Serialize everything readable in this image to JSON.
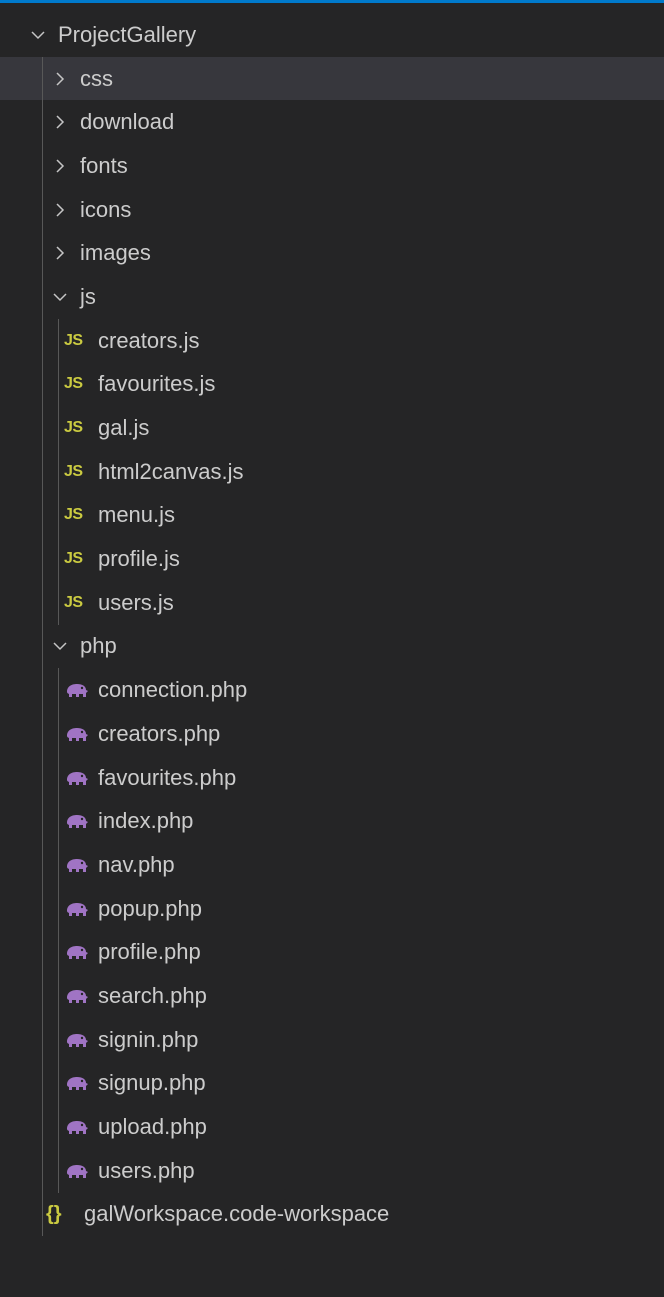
{
  "explorer": {
    "root": {
      "label": "ProjectGallery",
      "expanded": true
    },
    "folders_collapsed": [
      {
        "label": "css"
      },
      {
        "label": "download"
      },
      {
        "label": "fonts"
      },
      {
        "label": "icons"
      },
      {
        "label": "images"
      }
    ],
    "js_folder": {
      "label": "js",
      "files": [
        {
          "label": "creators.js"
        },
        {
          "label": "favourites.js"
        },
        {
          "label": "gal.js"
        },
        {
          "label": "html2canvas.js"
        },
        {
          "label": "menu.js"
        },
        {
          "label": "profile.js"
        },
        {
          "label": "users.js"
        }
      ]
    },
    "php_folder": {
      "label": "php",
      "files": [
        {
          "label": "connection.php"
        },
        {
          "label": "creators.php"
        },
        {
          "label": "favourites.php"
        },
        {
          "label": "index.php"
        },
        {
          "label": "nav.php"
        },
        {
          "label": "popup.php"
        },
        {
          "label": "profile.php"
        },
        {
          "label": "search.php"
        },
        {
          "label": "signin.php"
        },
        {
          "label": "signup.php"
        },
        {
          "label": "upload.php"
        },
        {
          "label": "users.php"
        }
      ]
    },
    "workspace_file": {
      "label": "galWorkspace.code-workspace"
    },
    "icons": {
      "js_badge": "JS",
      "workspace_badge": "{}"
    },
    "colors": {
      "background": "#252526",
      "selected_row": "#37373d",
      "text": "#cccccc",
      "js_icon": "#cbcb41",
      "php_icon": "#a074c4",
      "accent": "#007acc"
    }
  }
}
